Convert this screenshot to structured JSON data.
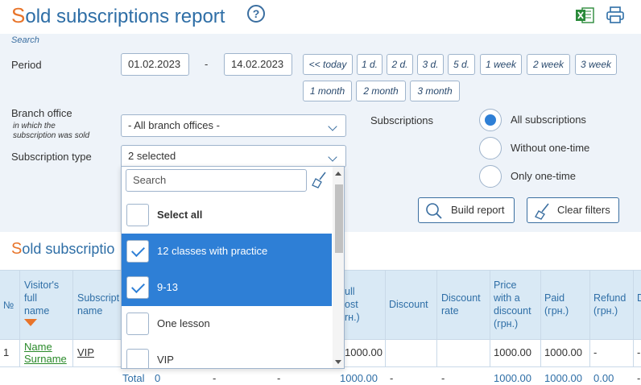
{
  "header": {
    "title_first": "S",
    "title_rest": "old subscriptions report",
    "help_glyph": "?",
    "icons": [
      "excel-export-icon",
      "print-icon"
    ]
  },
  "filters": {
    "search_label": "Search",
    "period": {
      "label": "Period",
      "from": "01.02.2023",
      "separator": "-",
      "to": "14.02.2023",
      "quick_buttons": [
        "<< today",
        "1 d.",
        "2 d.",
        "3 d.",
        "5 d.",
        "1 week",
        "2 week",
        "3 week",
        "1 month",
        "2 month",
        "3 month"
      ]
    },
    "branch": {
      "label": "Branch office",
      "sublabel_line1": "in which the",
      "sublabel_line2": "subscription was sold",
      "value": "- All branch offices -"
    },
    "subscription_type": {
      "label": "Subscription type",
      "value": "2 selected"
    },
    "subscriptions": {
      "label": "Subscriptions",
      "options": [
        "All subscriptions",
        "Without one-time",
        "Only one-time"
      ],
      "selected": "All subscriptions"
    },
    "build_report_label": "Build report",
    "clear_filters_label": "Clear filters"
  },
  "dropdown": {
    "search_placeholder": "Search",
    "select_all_label": "Select all",
    "items": [
      {
        "label": "12 classes with practice",
        "checked": true
      },
      {
        "label": "9-13",
        "checked": true
      },
      {
        "label": "One lesson",
        "checked": false
      },
      {
        "label": "VIP",
        "checked": false
      }
    ]
  },
  "table": {
    "section_title_first": "S",
    "section_title_rest": "old subscriptio",
    "headers": {
      "num": "№",
      "visitor": [
        "Visitor's",
        "full",
        "name"
      ],
      "subscription": [
        "Subscript",
        "name"
      ],
      "full_cost": [
        "ull",
        "ost",
        "rн.)"
      ],
      "discount": "Discount",
      "discount_rate": [
        "Discount",
        "rate"
      ],
      "price_discount": [
        "Price",
        "with a",
        "discount",
        "(грн.)"
      ],
      "paid": [
        "Paid",
        "(грн.)"
      ],
      "refund": [
        "Refund",
        "(грн.)"
      ],
      "last": "D"
    },
    "row": {
      "num": "1",
      "visitor_line1": "Name",
      "visitor_line2": "Surname",
      "subscription": "VIP",
      "full_cost": "1000.00",
      "discount": "",
      "discount_rate": "",
      "price_discount": "1000.00",
      "paid": "1000.00",
      "refund": "-",
      "last": "-"
    },
    "total": {
      "label": "Total",
      "count": "0",
      "c1": "-",
      "c2": "-",
      "full_cost": "1000.00",
      "discount": "-",
      "discount_rate": "-",
      "price_discount": "1000.00",
      "paid": "1000.00",
      "refund": "0.00",
      "last": "-"
    }
  },
  "colors": {
    "accent": "#2e7fd6",
    "title_blue": "#2e6ea6",
    "title_orange": "#e8742a",
    "panel_bg": "#eef3f9",
    "table_header_bg": "#d9e9f5",
    "link_green": "#2a8a2a"
  }
}
